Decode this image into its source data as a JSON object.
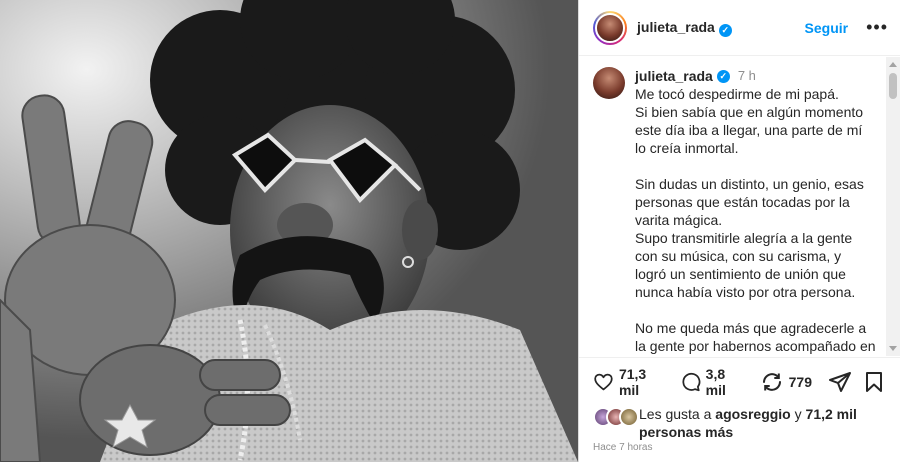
{
  "post": {
    "username": "julieta_rada",
    "follow_label": "Seguir",
    "more_label": "•••",
    "verified_mark": "✓"
  },
  "caption": {
    "username": "julieta_rada",
    "time": "7 h",
    "paragraphs": [
      "Me tocó despedirme de mi papá.\nSi bien sabía que en algún momento este día iba a llegar, una parte de mí lo creía inmortal.",
      "Sin dudas un distinto, un genio, esas personas que están tocadas por la varita mágica.\nSupo transmitirle alegría a la gente con su música, con su carisma, y logró un sentimiento de unión que nunca había visto por otra persona.",
      "No me queda más que agradecerle a la gente por habernos acompañado en estos días. Por la cantidad de mensajes"
    ]
  },
  "actions": {
    "likes_count": "71,3 mil",
    "comments_count": "3,8 mil",
    "reposts_count": "779",
    "icons": [
      "heart-icon",
      "comment-icon",
      "repost-icon",
      "share-icon",
      "bookmark-icon"
    ]
  },
  "likes": {
    "prefix": "Les gusta a ",
    "user": "agosreggio",
    "middle": " y ",
    "others": "71,2 mil personas más"
  },
  "timestamp": "Hace 7 horas",
  "colors": {
    "accent": "#0095f6",
    "text": "#262626",
    "muted": "#8e8e8e"
  }
}
